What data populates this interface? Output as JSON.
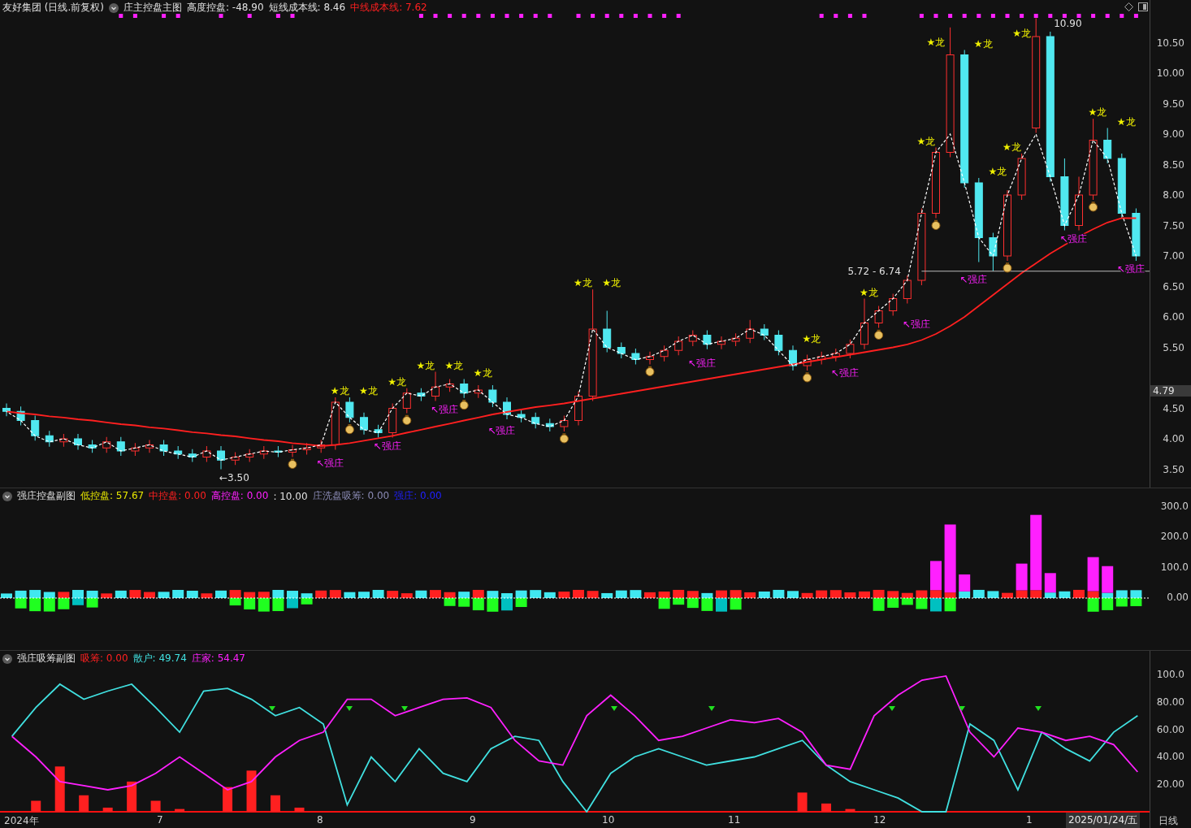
{
  "main_panel": {
    "title": "友好集团 (日线.前复权)",
    "indicator": "庄主控盘主图",
    "readings": [
      {
        "text": "高度控盘: -48.90",
        "color": "#e0e0e0"
      },
      {
        "text": "短线成本线: 8.46",
        "color": "#e0e0e0"
      },
      {
        "text": "中线成本线: 7.62",
        "color": "#ff2020"
      }
    ],
    "chart_data": {
      "type": "candlestick",
      "ylim": [
        3.2,
        11.2
      ],
      "yticks": [
        {
          "value": 10.5,
          "label": "10.50"
        },
        {
          "value": 10,
          "label": "10.00"
        },
        {
          "value": 9.5,
          "label": "9.50"
        },
        {
          "value": 9,
          "label": "9.00"
        },
        {
          "value": 8.5,
          "label": "8.50"
        },
        {
          "value": 8,
          "label": "8.00"
        },
        {
          "value": 7.5,
          "label": "7.50"
        },
        {
          "value": 7,
          "label": "7.00"
        },
        {
          "value": 6.5,
          "label": "6.50"
        },
        {
          "value": 6,
          "label": "6.00"
        },
        {
          "value": 5.5,
          "label": "5.50"
        },
        {
          "value": 4.5,
          "label": "4.50"
        },
        {
          "value": 4,
          "label": "4.00"
        },
        {
          "value": 3.5,
          "label": "3.50"
        }
      ],
      "ohlc": [
        [
          4.5,
          4.58,
          4.37,
          4.45
        ],
        [
          4.45,
          4.53,
          4.22,
          4.3
        ],
        [
          4.3,
          4.38,
          3.97,
          4.05
        ],
        [
          4.05,
          4.13,
          3.87,
          3.95
        ],
        [
          3.95,
          4.08,
          3.87,
          4.0
        ],
        [
          4.0,
          4.08,
          3.82,
          3.9
        ],
        [
          3.9,
          3.98,
          3.77,
          3.85
        ],
        [
          3.85,
          4.03,
          3.77,
          3.95
        ],
        [
          3.95,
          4.03,
          3.72,
          3.8
        ],
        [
          3.8,
          3.93,
          3.72,
          3.85
        ],
        [
          3.85,
          3.98,
          3.77,
          3.9
        ],
        [
          3.9,
          3.98,
          3.72,
          3.8
        ],
        [
          3.8,
          3.88,
          3.67,
          3.75
        ],
        [
          3.75,
          3.83,
          3.62,
          3.7
        ],
        [
          3.7,
          3.88,
          3.62,
          3.8
        ],
        [
          3.8,
          3.88,
          3.5,
          3.65
        ],
        [
          3.65,
          3.78,
          3.57,
          3.7
        ],
        [
          3.7,
          3.83,
          3.62,
          3.75
        ],
        [
          3.75,
          3.88,
          3.67,
          3.8
        ],
        [
          3.8,
          3.88,
          3.7,
          3.78
        ],
        [
          3.78,
          3.9,
          3.7,
          3.82
        ],
        [
          3.82,
          3.93,
          3.74,
          3.85
        ],
        [
          3.85,
          3.98,
          3.77,
          3.9
        ],
        [
          3.9,
          4.68,
          3.82,
          4.6
        ],
        [
          4.6,
          4.68,
          4.27,
          4.35
        ],
        [
          4.35,
          4.43,
          4.07,
          4.15
        ],
        [
          4.15,
          4.23,
          4.02,
          4.1
        ],
        [
          4.1,
          4.58,
          4.02,
          4.5
        ],
        [
          4.5,
          4.83,
          4.42,
          4.75
        ],
        [
          4.75,
          4.83,
          4.62,
          4.7
        ],
        [
          4.7,
          5.1,
          4.62,
          4.85
        ],
        [
          4.85,
          4.98,
          4.77,
          4.9
        ],
        [
          4.9,
          4.98,
          4.67,
          4.75
        ],
        [
          4.75,
          4.88,
          4.67,
          4.8
        ],
        [
          4.8,
          4.88,
          4.52,
          4.6
        ],
        [
          4.6,
          4.68,
          4.32,
          4.4
        ],
        [
          4.4,
          4.48,
          4.27,
          4.35
        ],
        [
          4.35,
          4.43,
          4.17,
          4.25
        ],
        [
          4.25,
          4.33,
          4.12,
          4.2
        ],
        [
          4.2,
          4.38,
          4.12,
          4.3
        ],
        [
          4.3,
          4.78,
          4.22,
          4.7
        ],
        [
          4.7,
          6.45,
          4.62,
          5.8
        ],
        [
          5.8,
          6.1,
          5.42,
          5.5
        ],
        [
          5.5,
          5.58,
          5.32,
          5.4
        ],
        [
          5.4,
          5.48,
          5.22,
          5.3
        ],
        [
          5.3,
          5.43,
          5.22,
          5.35
        ],
        [
          5.35,
          5.53,
          5.27,
          5.45
        ],
        [
          5.45,
          5.68,
          5.37,
          5.6
        ],
        [
          5.6,
          5.78,
          5.52,
          5.7
        ],
        [
          5.7,
          5.78,
          5.47,
          5.55
        ],
        [
          5.55,
          5.68,
          5.47,
          5.6
        ],
        [
          5.6,
          5.73,
          5.52,
          5.65
        ],
        [
          5.65,
          5.95,
          5.57,
          5.8
        ],
        [
          5.8,
          5.88,
          5.62,
          5.7
        ],
        [
          5.7,
          5.78,
          5.37,
          5.45
        ],
        [
          5.45,
          5.53,
          5.12,
          5.2
        ],
        [
          5.2,
          5.38,
          5.12,
          5.3
        ],
        [
          5.3,
          5.43,
          5.22,
          5.35
        ],
        [
          5.35,
          5.48,
          5.27,
          5.4
        ],
        [
          5.4,
          5.63,
          5.32,
          5.55
        ],
        [
          5.55,
          6.3,
          5.47,
          5.9
        ],
        [
          5.9,
          6.18,
          5.82,
          6.1
        ],
        [
          6.1,
          6.38,
          6.02,
          6.3
        ],
        [
          6.3,
          6.68,
          6.22,
          6.6
        ],
        [
          6.6,
          7.78,
          6.52,
          7.7
        ],
        [
          7.7,
          8.78,
          7.62,
          8.7
        ],
        [
          8.7,
          10.75,
          8.62,
          10.3
        ],
        [
          10.3,
          10.38,
          8.12,
          8.2
        ],
        [
          8.2,
          8.28,
          6.9,
          7.3
        ],
        [
          7.3,
          7.38,
          6.75,
          7.0
        ],
        [
          7.0,
          8.08,
          6.92,
          8.0
        ],
        [
          8.0,
          8.68,
          7.92,
          8.6
        ],
        [
          9.1,
          10.9,
          9.02,
          10.6
        ],
        [
          10.6,
          10.68,
          8.22,
          8.3
        ],
        [
          8.3,
          8.6,
          7.42,
          7.5
        ],
        [
          7.5,
          8.3,
          7.42,
          8.0
        ],
        [
          8.0,
          9.25,
          7.92,
          8.9
        ],
        [
          8.9,
          9.1,
          8.52,
          8.6
        ],
        [
          8.6,
          8.68,
          7.62,
          7.7
        ],
        [
          7.7,
          7.78,
          6.92,
          7.0
        ]
      ],
      "series": [
        {
          "type": "line",
          "color": "#ff2020",
          "values": [
            4.45,
            4.42,
            4.4,
            4.37,
            4.35,
            4.32,
            4.3,
            4.27,
            4.24,
            4.22,
            4.19,
            4.17,
            4.14,
            4.11,
            4.09,
            4.06,
            4.04,
            4.01,
            3.98,
            3.96,
            3.93,
            3.91,
            3.88,
            3.9,
            3.93,
            3.97,
            4.01,
            4.05,
            4.1,
            4.15,
            4.2,
            4.25,
            4.3,
            4.35,
            4.4,
            4.44,
            4.48,
            4.52,
            4.55,
            4.58,
            4.62,
            4.66,
            4.7,
            4.74,
            4.78,
            4.82,
            4.86,
            4.9,
            4.94,
            4.98,
            5.02,
            5.06,
            5.1,
            5.14,
            5.18,
            5.22,
            5.26,
            5.3,
            5.34,
            5.38,
            5.42,
            5.46,
            5.5,
            5.55,
            5.62,
            5.72,
            5.85,
            6.0,
            6.18,
            6.36,
            6.54,
            6.72,
            6.88,
            7.04,
            7.18,
            7.32,
            7.44,
            7.55,
            7.62,
            7.62
          ]
        },
        {
          "type": "line",
          "line_style": "dashed",
          "color": "#ffffff",
          "values": [
            4.45,
            4.3,
            4.05,
            3.95,
            4.0,
            3.9,
            3.85,
            3.95,
            3.8,
            3.85,
            3.9,
            3.8,
            3.75,
            3.7,
            3.8,
            3.65,
            3.7,
            3.75,
            3.8,
            3.78,
            3.82,
            3.85,
            3.9,
            4.6,
            4.35,
            4.15,
            4.1,
            4.5,
            4.75,
            4.7,
            4.85,
            4.9,
            4.75,
            4.8,
            4.6,
            4.4,
            4.35,
            4.25,
            4.2,
            4.3,
            4.7,
            5.8,
            5.5,
            5.4,
            5.3,
            5.35,
            5.45,
            5.6,
            5.7,
            5.55,
            5.6,
            5.65,
            5.8,
            5.7,
            5.45,
            5.2,
            5.3,
            5.35,
            5.4,
            5.55,
            5.9,
            6.1,
            6.3,
            6.6,
            7.7,
            8.7,
            9.0,
            8.2,
            7.3,
            7.0,
            8.0,
            8.6,
            9.0,
            8.3,
            7.5,
            8.0,
            8.9,
            8.6,
            7.7,
            7.0
          ]
        },
        {
          "type": "scatter",
          "color": "#ff20ff",
          "values": [
            null,
            null,
            null,
            null,
            null,
            null,
            null,
            null,
            10.94,
            10.94,
            null,
            10.94,
            10.94,
            null,
            null,
            10.94,
            null,
            10.94,
            null,
            10.94,
            10.94,
            null,
            null,
            null,
            null,
            null,
            null,
            null,
            null,
            10.94,
            10.94,
            10.94,
            10.94,
            10.94,
            10.94,
            10.94,
            10.94,
            10.94,
            10.94,
            null,
            10.94,
            10.94,
            10.94,
            10.94,
            10.94,
            10.94,
            10.94,
            10.94,
            null,
            null,
            null,
            null,
            null,
            null,
            null,
            null,
            null,
            10.94,
            10.94,
            10.94,
            10.94,
            null,
            null,
            null,
            10.94,
            10.94,
            10.94,
            10.94,
            10.94,
            10.94,
            10.94,
            10.94,
            10.94,
            10.94,
            10.94,
            10.94,
            10.94,
            10.94,
            10.94,
            10.94
          ]
        }
      ]
    },
    "price_tag": "4.79",
    "high_label": "10.90",
    "low_label": "←3.50",
    "range_label": "5.72 - 6.74",
    "dragon_labels": [
      "★龙",
      "★龙",
      "★龙",
      "★龙",
      "★龙",
      "★龙",
      "★龙",
      "★龙",
      "★龙",
      "★龙",
      "★龙",
      "★龙",
      "★龙",
      "★龙",
      "★龙",
      "★龙",
      "★龙",
      "★龙"
    ],
    "strong_labels": [
      "↖强庄",
      "↖强庄",
      "↖强庄",
      "↖强庄",
      "↖强庄",
      "↖强庄",
      "↖强庄",
      "↖强庄",
      "↖强庄",
      "↖强庄"
    ]
  },
  "sub_panel_1": {
    "indicator": "强庄控盘副图",
    "readings": [
      {
        "text": "低控盘: 57.67",
        "color": "#e6e600"
      },
      {
        "text": "中控盘: 0.00",
        "color": "#ff2020"
      },
      {
        "text": "高控盘: 0.00",
        "color": "#ff20ff"
      },
      {
        "text": ": 10.00",
        "color": "#e0e0e0"
      },
      {
        "text": "庄洗盘吸筹: 0.00",
        "color": "#8a8ab4"
      },
      {
        "text": "强庄: 0.00",
        "color": "#2020ff"
      }
    ],
    "y_ticks": [
      "300.0",
      "200.0",
      "100.0",
      "0.00"
    ]
  },
  "sub_panel_2": {
    "indicator": "强庄吸筹副图",
    "readings": [
      {
        "text": "吸筹: 0.00",
        "color": "#ff2020"
      },
      {
        "text": "散户: 49.74",
        "color": "#40e0e0"
      },
      {
        "text": "庄家: 54.47",
        "color": "#ff20ff"
      }
    ],
    "chart_data": {
      "type": "line",
      "ylim": [
        0,
        117.3
      ],
      "yticks": [
        {
          "value": 100,
          "label": "100.0"
        },
        {
          "value": 80,
          "label": "80.00"
        },
        {
          "value": 60,
          "label": "60.00"
        },
        {
          "value": 40,
          "label": "40.00"
        },
        {
          "value": 20,
          "label": "20.00"
        }
      ],
      "series": [
        {
          "type": "bar",
          "color": "#ff2020",
          "values": [
            0,
            8,
            33,
            12,
            3,
            22,
            8,
            2,
            0,
            18,
            30,
            12,
            3,
            0,
            0,
            0,
            0,
            0,
            0,
            0,
            0,
            0,
            0,
            0,
            0,
            0,
            0,
            0,
            0,
            0,
            0,
            0,
            0,
            14,
            6,
            2,
            0,
            0,
            0,
            0,
            0,
            0,
            0,
            0,
            0,
            0,
            0,
            0
          ]
        },
        {
          "color": "#40e0e0",
          "values": [
            55,
            76,
            93,
            82,
            88,
            93,
            76,
            58,
            88,
            90,
            82,
            70,
            76,
            64,
            5,
            40,
            22,
            46,
            28,
            22,
            46,
            55,
            52,
            22,
            0,
            28,
            40,
            46,
            40,
            34,
            37,
            40,
            46,
            52,
            34,
            22,
            16,
            10,
            0,
            0,
            64,
            52,
            16,
            58,
            46,
            37,
            58,
            70
          ]
        },
        {
          "color": "#ff20ff",
          "values": [
            55,
            40,
            22,
            19,
            16,
            19,
            28,
            40,
            28,
            16,
            22,
            40,
            52,
            58,
            82,
            82,
            70,
            76,
            82,
            83,
            76,
            52,
            37,
            34,
            70,
            85,
            70,
            52,
            55,
            61,
            67,
            65,
            68,
            58,
            34,
            31,
            70,
            85,
            96,
            99,
            58,
            40,
            61,
            58,
            52,
            55,
            49,
            29
          ]
        }
      ]
    }
  },
  "x_axis": {
    "labels": [
      "2024年",
      "7",
      "8",
      "9",
      "10",
      "11",
      "12",
      "1"
    ],
    "current_date": "2025/01/24/五",
    "period": "日线"
  }
}
